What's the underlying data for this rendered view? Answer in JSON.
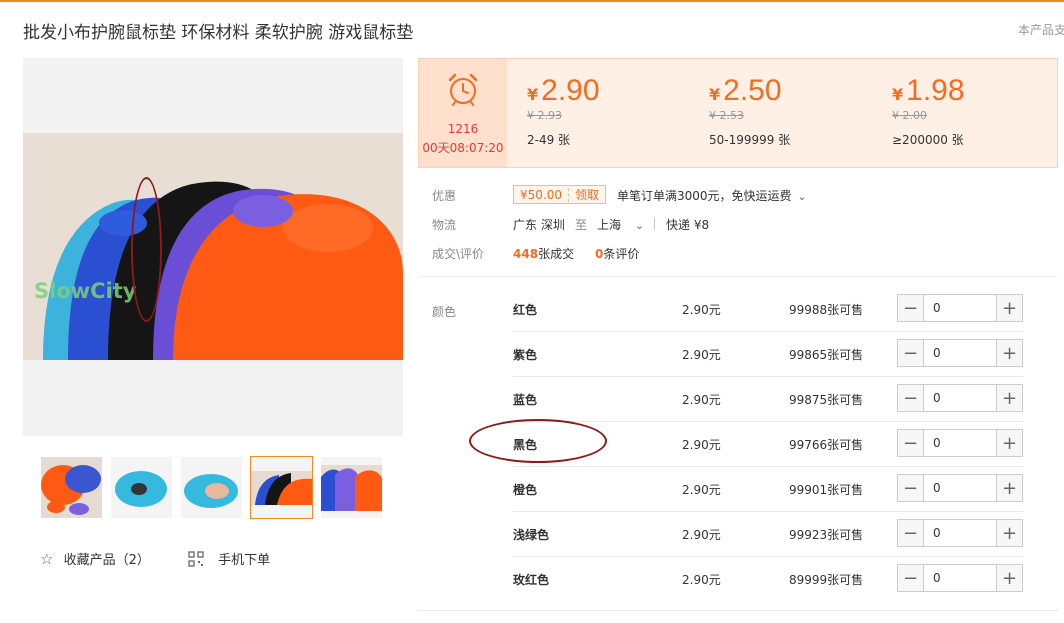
{
  "product": {
    "title": "批发小布护腕鼠标垫 环保材料 柔软护腕 游戏鼠标垫",
    "support_note": "本产品支"
  },
  "gallery": {
    "watermark": "SlowCity",
    "thumbnails": [
      {
        "name": "thumb-1",
        "active": false
      },
      {
        "name": "thumb-2",
        "active": false
      },
      {
        "name": "thumb-3",
        "active": false
      },
      {
        "name": "thumb-4",
        "active": true
      },
      {
        "name": "thumb-5",
        "active": false
      }
    ],
    "favorite_label": "收藏产品（2）",
    "mobile_order_label": "手机下单"
  },
  "flash_sale": {
    "count": "1216",
    "countdown": "00天08:07:20",
    "icon": "alarm-clock-icon"
  },
  "price_tiers": [
    {
      "currency": "¥",
      "price": "2.90",
      "original": "¥ 2.93",
      "quantity": "2-49 张"
    },
    {
      "currency": "¥",
      "price": "2.50",
      "original": "¥ 2.53",
      "quantity": "50-199999 张"
    },
    {
      "currency": "¥",
      "price": "1.98",
      "original": "¥ 2.00",
      "quantity": "≥200000 张"
    }
  ],
  "info": {
    "discount_label": "优惠",
    "coupon_amount": "¥50.00",
    "coupon_action": "领取",
    "promo_text": "单笔订单满3000元，免快运运费",
    "logistics_label": "物流",
    "from_location": "广东 深圳",
    "to_word": "至",
    "to_location": "上海",
    "express": "快递 ¥8",
    "deals_label": "成交\\评价",
    "deals_count": "448",
    "deals_unit": "张成交",
    "reviews_count": "0",
    "reviews_unit": "条评价"
  },
  "sku": {
    "label": "颜色",
    "rows": [
      {
        "color": "红色",
        "price": "2.90元",
        "stock": "99988张可售",
        "qty": "0"
      },
      {
        "color": "紫色",
        "price": "2.90元",
        "stock": "99865张可售",
        "qty": "0"
      },
      {
        "color": "蓝色",
        "price": "2.90元",
        "stock": "99875张可售",
        "qty": "0"
      },
      {
        "color": "黑色",
        "price": "2.90元",
        "stock": "99766张可售",
        "qty": "0"
      },
      {
        "color": "橙色",
        "price": "2.90元",
        "stock": "99901张可售",
        "qty": "0"
      },
      {
        "color": "浅绿色",
        "price": "2.90元",
        "stock": "99923张可售",
        "qty": "0"
      },
      {
        "color": "玫红色",
        "price": "2.90元",
        "stock": "89999张可售",
        "qty": "0"
      }
    ],
    "minus_symbol": "−",
    "plus_symbol": "+"
  },
  "colors": {
    "accent": "#f26c21",
    "annotation": "#8b1a1a"
  }
}
